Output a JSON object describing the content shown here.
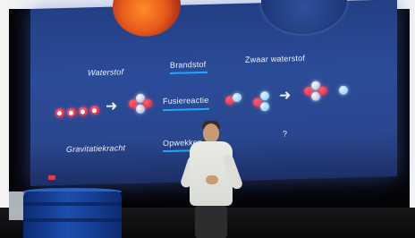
{
  "slide": {
    "row1": {
      "left": "Waterstof",
      "middle": "Brandstof",
      "right": "Zwaar waterstof"
    },
    "row2": {
      "process": "Fusiereactie"
    },
    "row3": {
      "left": "Gravitatiekracht",
      "middle": "Opwekken",
      "right": "?"
    }
  },
  "colors": {
    "screen_blue": "#2b4c98",
    "accent_underline": "#1ea9ff",
    "atom_red": "#d9243d"
  }
}
